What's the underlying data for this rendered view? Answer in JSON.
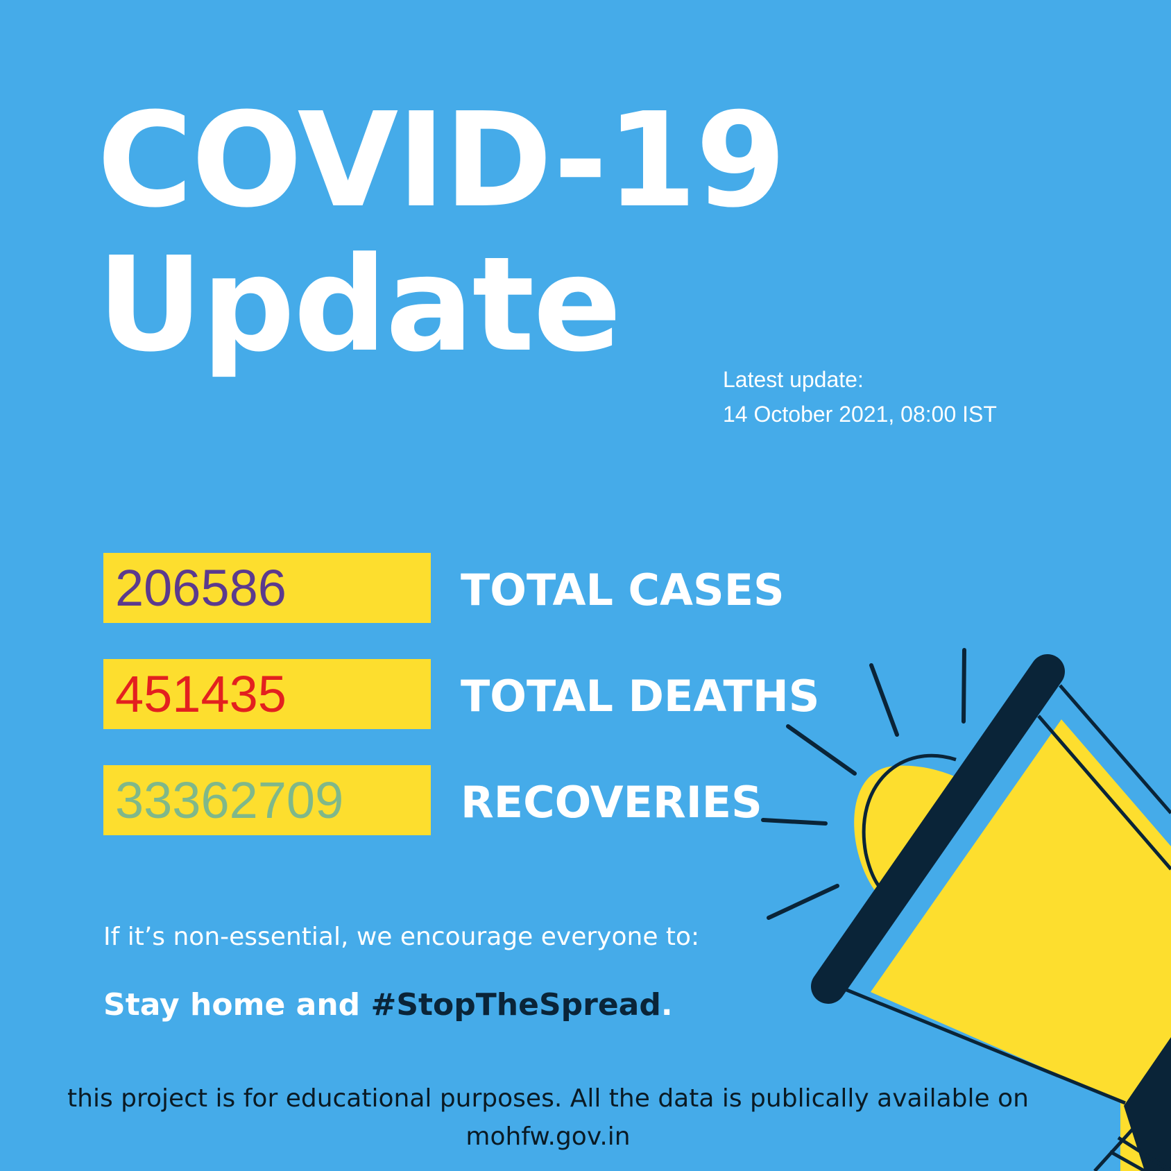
{
  "title": {
    "line1": "COVID-19",
    "line2": "Update"
  },
  "latest_update": {
    "label": "Latest update:",
    "timestamp": "14 October 2021, 08:00 IST"
  },
  "stats": [
    {
      "value": "206586",
      "label": "TOTAL CASES",
      "color": "#5B3A8E"
    },
    {
      "value": "451435",
      "label": "TOTAL DEATHS",
      "color": "#E3201F"
    },
    {
      "value": "33362709",
      "label": "RECOVERIES",
      "color": "#7FB88A"
    }
  ],
  "message": {
    "encourage": "If it’s non-essential, we encourage everyone to:",
    "stay_prefix": "Stay home and ",
    "hashtag": "#StopTheSpread",
    "stay_suffix": "."
  },
  "footer": {
    "line1": "this project is for educational purposes. All the data is publically available on",
    "line2": "mohfw.gov.in"
  },
  "colors": {
    "background": "#45ABE9",
    "box": "#FDDE2E",
    "dark": "#0A2438"
  },
  "illustration": "megaphone-icon"
}
